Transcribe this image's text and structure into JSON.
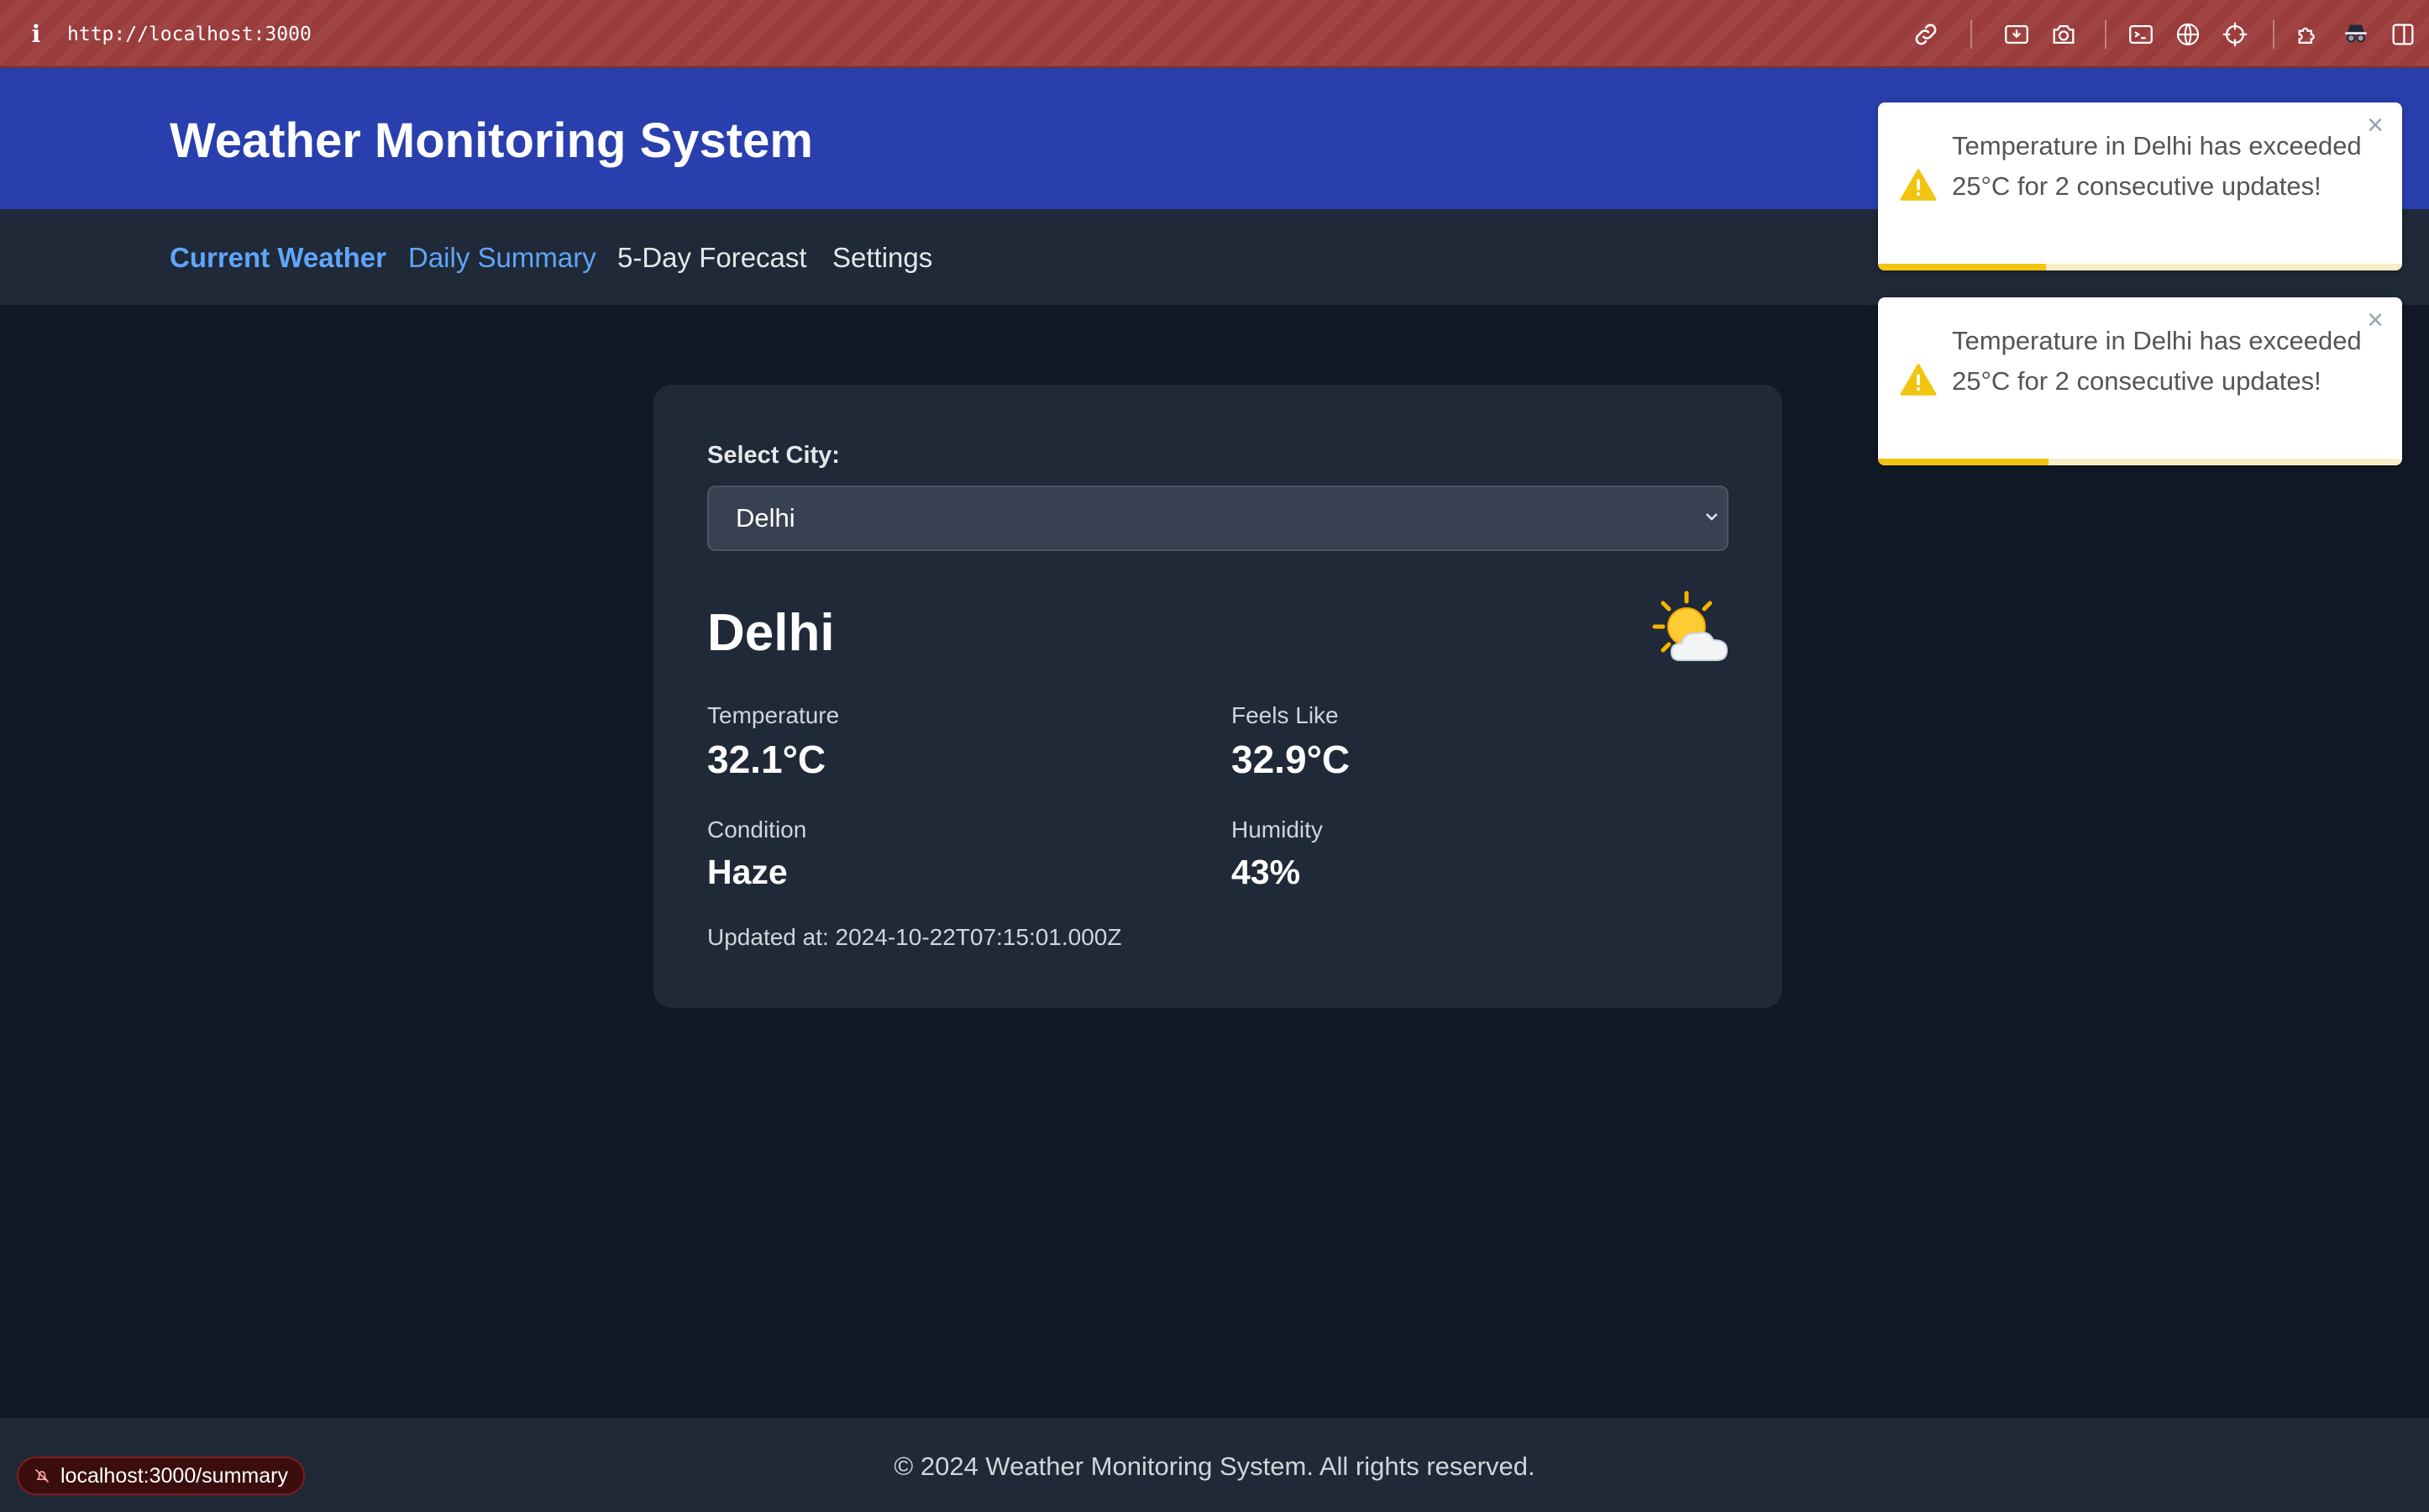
{
  "browser": {
    "url": "http://localhost:3000",
    "info_icon": "i",
    "toolbar_icons": [
      "link-icon",
      "screenshot-icon",
      "camera-icon",
      "terminal-icon",
      "globe-icon",
      "crosshair-icon",
      "extensions-icon",
      "incognito-icon",
      "sidebar-icon"
    ]
  },
  "header": {
    "title": "Weather Monitoring System"
  },
  "nav": {
    "items": [
      {
        "label": "Current Weather",
        "state": "active"
      },
      {
        "label": "Daily Summary",
        "state": "hover"
      },
      {
        "label": "5-Day Forecast",
        "state": "default"
      },
      {
        "label": "Settings",
        "state": "default"
      }
    ]
  },
  "city_card": {
    "select_label": "Select City:",
    "selected_city": "Delhi",
    "city_name": "Delhi",
    "weather_icon": "sun-behind-cloud-icon",
    "temperature_label": "Temperature",
    "temperature_value": "32.1°C",
    "feels_like_label": "Feels Like",
    "feels_like_value": "32.9°C",
    "condition_label": "Condition",
    "condition_value": "Haze",
    "humidity_label": "Humidity",
    "humidity_value": "43%",
    "updated_at": "Updated at: 2024-10-22T07:15:01.000Z"
  },
  "toasts": [
    {
      "message": "Temperature in Delhi has exceeded 25°C for 2 consecutive updates!",
      "close": "×",
      "icon": "warning-icon",
      "progress": 0.32
    },
    {
      "message": "Temperature in Delhi has exceeded 25°C for 2 consecutive updates!",
      "close": "×",
      "icon": "warning-icon",
      "progress": 0.325
    }
  ],
  "footer": {
    "text": "© 2024 Weather Monitoring System. All rights reserved."
  },
  "status_bar": {
    "link_preview": "localhost:3000/summary"
  },
  "colors": {
    "browser_bar": "#9b3c3c",
    "header_bg": "#283fad",
    "nav_bg": "#1f2937",
    "page_bg": "#111827",
    "accent": "#60a5fa",
    "toast_progress": "#f1c40f"
  }
}
